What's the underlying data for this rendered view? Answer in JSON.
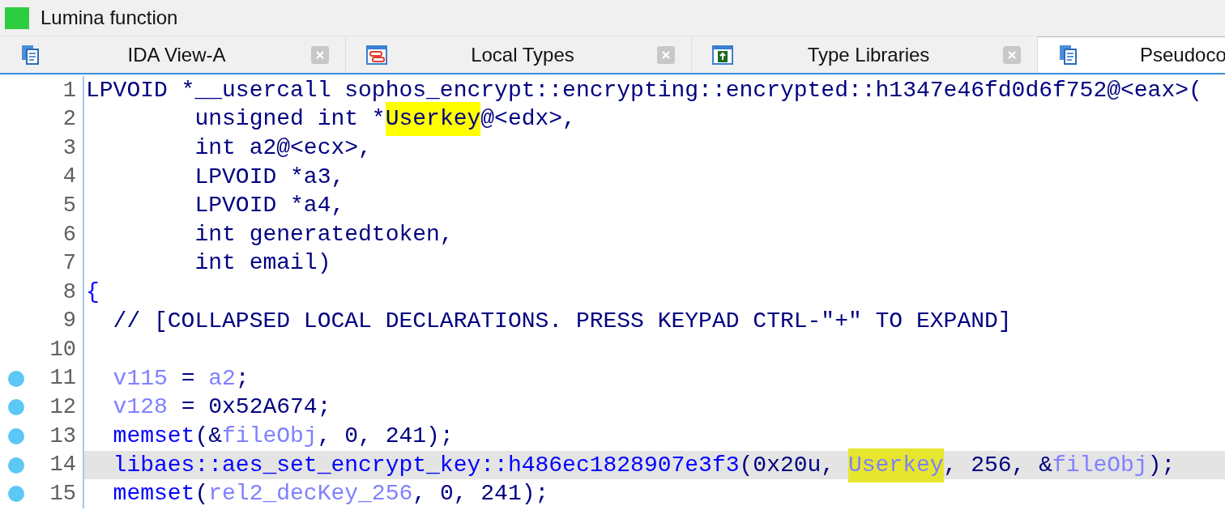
{
  "window": {
    "title": "Lumina function"
  },
  "tabs": [
    {
      "label": "IDA View-A",
      "kind": "disasm",
      "selected": false,
      "close_button": true
    },
    {
      "label": "Local Types",
      "kind": "types",
      "selected": false,
      "close_button": true
    },
    {
      "label": "Type Libraries",
      "kind": "library",
      "selected": false,
      "close_button": true
    },
    {
      "label": "Pseudoco",
      "kind": "pseudocode",
      "selected": true,
      "close_button": false
    }
  ],
  "lines": [
    {
      "number": "1",
      "breakpoint": false,
      "current": false,
      "tokens": [
        {
          "kind": "plain",
          "text": "LPVOID *__usercall sophos_encrypt::encrypting::encrypted::h1347e46fd0d6f752@<eax>("
        }
      ]
    },
    {
      "number": "2",
      "breakpoint": false,
      "current": false,
      "tokens": [
        {
          "kind": "plain",
          "text": "        unsigned int *"
        },
        {
          "kind": "match_plain",
          "text": "Userkey"
        },
        {
          "kind": "plain",
          "text": "@<edx>,"
        }
      ]
    },
    {
      "number": "3",
      "breakpoint": false,
      "current": false,
      "tokens": [
        {
          "kind": "plain",
          "text": "        int a2@<ecx>,"
        }
      ]
    },
    {
      "number": "4",
      "breakpoint": false,
      "current": false,
      "tokens": [
        {
          "kind": "plain",
          "text": "        LPVOID *a3,"
        }
      ]
    },
    {
      "number": "5",
      "breakpoint": false,
      "current": false,
      "tokens": [
        {
          "kind": "plain",
          "text": "        LPVOID *a4,"
        }
      ]
    },
    {
      "number": "6",
      "breakpoint": false,
      "current": false,
      "tokens": [
        {
          "kind": "plain",
          "text": "        int generatedtoken,"
        }
      ]
    },
    {
      "number": "7",
      "breakpoint": false,
      "current": false,
      "tokens": [
        {
          "kind": "plain",
          "text": "        int email)"
        }
      ]
    },
    {
      "number": "8",
      "breakpoint": false,
      "current": false,
      "tokens": [
        {
          "kind": "func",
          "text": "{"
        }
      ]
    },
    {
      "number": "9",
      "breakpoint": false,
      "current": false,
      "tokens": [
        {
          "kind": "plain",
          "text": "  // [COLLAPSED LOCAL DECLARATIONS. PRESS KEYPAD CTRL-\"+\" TO EXPAND]"
        }
      ]
    },
    {
      "number": "10",
      "breakpoint": false,
      "current": false
    },
    {
      "number": "11",
      "breakpoint": true,
      "current": false,
      "tokens": [
        {
          "kind": "var",
          "text": "  v115"
        },
        {
          "kind": "plain",
          "text": " = "
        },
        {
          "kind": "var",
          "text": "a2"
        },
        {
          "kind": "plain",
          "text": ";"
        }
      ]
    },
    {
      "number": "12",
      "breakpoint": true,
      "current": false,
      "tokens": [
        {
          "kind": "var",
          "text": "  v128"
        },
        {
          "kind": "plain",
          "text": " = 0x52A674;"
        }
      ]
    },
    {
      "number": "13",
      "breakpoint": true,
      "current": false,
      "tokens": [
        {
          "kind": "func",
          "text": "  memset"
        },
        {
          "kind": "plain",
          "text": "(&"
        },
        {
          "kind": "var",
          "text": "fileObj"
        },
        {
          "kind": "plain",
          "text": ", 0, 241);"
        }
      ]
    },
    {
      "number": "14",
      "breakpoint": true,
      "current": true,
      "tokens": [
        {
          "kind": "func",
          "text": "  libaes::aes_set_encrypt_key::h486ec1828907e3f3"
        },
        {
          "kind": "plain",
          "text": "(0x20u, "
        },
        {
          "kind": "match_var",
          "text": "Userkey"
        },
        {
          "kind": "plain",
          "text": ", 256, &"
        },
        {
          "kind": "var",
          "text": "fileObj"
        },
        {
          "kind": "plain",
          "text": ");"
        }
      ]
    },
    {
      "number": "15",
      "breakpoint": true,
      "current": false,
      "tokens": [
        {
          "kind": "func",
          "text": "  memset"
        },
        {
          "kind": "plain",
          "text": "("
        },
        {
          "kind": "var",
          "text": "rel2_decKey_256"
        },
        {
          "kind": "plain",
          "text": ", 0, 241);"
        }
      ]
    }
  ]
}
